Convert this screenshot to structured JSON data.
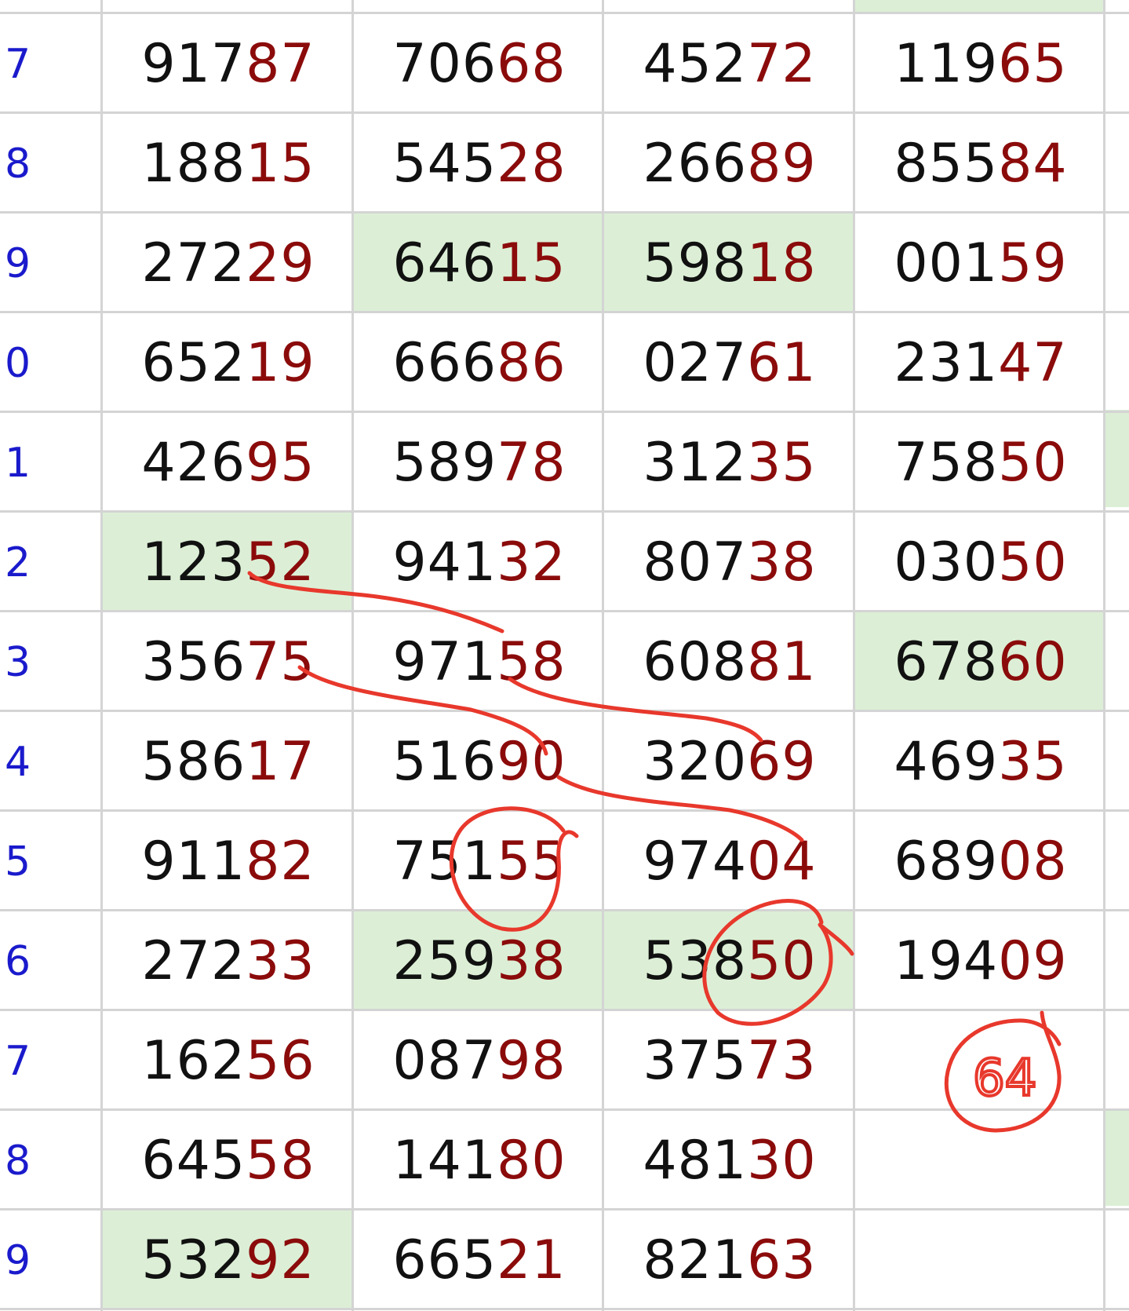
{
  "colors": {
    "label": "#1a1acc",
    "lead": "#111111",
    "tail": "#8b0b0b",
    "highlight": "#dcefd6",
    "ink": "#e8382c"
  },
  "rows": [
    {
      "label": "7",
      "cells": [
        {
          "lead": "917",
          "tail": "87"
        },
        {
          "lead": "706",
          "tail": "68"
        },
        {
          "lead": "452",
          "tail": "72"
        },
        {
          "lead": "119",
          "tail": "65"
        }
      ]
    },
    {
      "label": "8",
      "cells": [
        {
          "lead": "188",
          "tail": "15"
        },
        {
          "lead": "545",
          "tail": "28"
        },
        {
          "lead": "266",
          "tail": "89"
        },
        {
          "lead": "855",
          "tail": "84"
        }
      ]
    },
    {
      "label": "9",
      "cells": [
        {
          "lead": "272",
          "tail": "29"
        },
        {
          "lead": "646",
          "tail": "15",
          "hl": true
        },
        {
          "lead": "598",
          "tail": "18",
          "hl": true
        },
        {
          "lead": "001",
          "tail": "59"
        }
      ]
    },
    {
      "label": "0",
      "cells": [
        {
          "lead": "652",
          "tail": "19"
        },
        {
          "lead": "666",
          "tail": "86"
        },
        {
          "lead": "027",
          "tail": "61"
        },
        {
          "lead": "231",
          "tail": "47"
        }
      ]
    },
    {
      "label": "1",
      "cells": [
        {
          "lead": "426",
          "tail": "95"
        },
        {
          "lead": "589",
          "tail": "78"
        },
        {
          "lead": "312",
          "tail": "35"
        },
        {
          "lead": "758",
          "tail": "50"
        }
      ]
    },
    {
      "label": "2",
      "cells": [
        {
          "lead": "123",
          "tail": "52",
          "hl": true
        },
        {
          "lead": "941",
          "tail": "32"
        },
        {
          "lead": "807",
          "tail": "38"
        },
        {
          "lead": "030",
          "tail": "50"
        }
      ]
    },
    {
      "label": "3",
      "cells": [
        {
          "lead": "356",
          "tail": "75"
        },
        {
          "lead": "971",
          "tail": "58"
        },
        {
          "lead": "608",
          "tail": "81"
        },
        {
          "lead": "678",
          "tail": "60",
          "hl": true
        }
      ]
    },
    {
      "label": "4",
      "cells": [
        {
          "lead": "586",
          "tail": "17"
        },
        {
          "lead": "516",
          "tail": "90"
        },
        {
          "lead": "320",
          "tail": "69"
        },
        {
          "lead": "469",
          "tail": "35"
        }
      ]
    },
    {
      "label": "5",
      "cells": [
        {
          "lead": "911",
          "tail": "82"
        },
        {
          "lead": "751",
          "tail": "55"
        },
        {
          "lead": "974",
          "tail": "04"
        },
        {
          "lead": "689",
          "tail": "08"
        }
      ]
    },
    {
      "label": "6",
      "cells": [
        {
          "lead": "272",
          "tail": "33"
        },
        {
          "lead": "259",
          "tail": "38",
          "hl": true
        },
        {
          "lead": "538",
          "tail": "50",
          "hl": true
        },
        {
          "lead": "194",
          "tail": "09"
        }
      ]
    },
    {
      "label": "7",
      "cells": [
        {
          "lead": "162",
          "tail": "56"
        },
        {
          "lead": "087",
          "tail": "98"
        },
        {
          "lead": "375",
          "tail": "73"
        },
        {
          "lead": "",
          "tail": ""
        }
      ]
    },
    {
      "label": "8",
      "cells": [
        {
          "lead": "645",
          "tail": "58"
        },
        {
          "lead": "141",
          "tail": "80"
        },
        {
          "lead": "481",
          "tail": "30"
        },
        {
          "lead": "",
          "tail": ""
        }
      ]
    },
    {
      "label": "9",
      "cells": [
        {
          "lead": "532",
          "tail": "92",
          "hl": true
        },
        {
          "lead": "665",
          "tail": "21"
        },
        {
          "lead": "821",
          "tail": "63"
        },
        {
          "lead": "",
          "tail": ""
        }
      ]
    }
  ],
  "handwritten_note": "64"
}
